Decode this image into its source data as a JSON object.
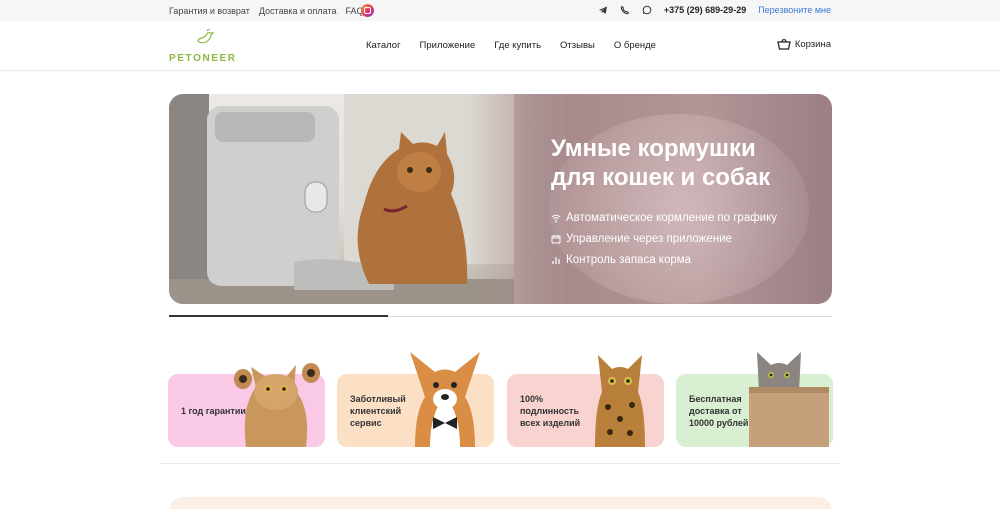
{
  "topbar": {
    "links": [
      "Гарантия и возврат",
      "Доставка и оплата",
      "FAQ"
    ],
    "instagram_icon": "instagram-icon",
    "messenger_icons": [
      "telegram-icon",
      "viber-icon",
      "whatsapp-icon"
    ],
    "phone": "+375 (29) 689-29-29",
    "callback": "Перезвоните мне"
  },
  "header": {
    "logo": "PETONEER",
    "nav": [
      "Каталог",
      "Приложение",
      "Где купить",
      "Отзывы",
      "О бренде"
    ],
    "cart": "Корзина"
  },
  "hero": {
    "title_line1": "Умные кормушки",
    "title_line2": "для кошек и собак",
    "features": [
      {
        "icon": "wifi-icon",
        "text": "Автоматическое кормление по графику"
      },
      {
        "icon": "calendar-icon",
        "text": "Управление через приложение"
      },
      {
        "icon": "bar-chart-icon",
        "text": "Контроль запаса корма"
      }
    ]
  },
  "slider": {
    "progress": 0.33
  },
  "features": [
    {
      "text": "1 год гарантии",
      "color": "#f9c9e6"
    },
    {
      "text": "Заботливый клиентский сервис",
      "color": "#fbe0c6"
    },
    {
      "text": "100% подлинность всех изделий",
      "color": "#f8d3cf"
    },
    {
      "text": "Бесплатная доставка от 10000 рублей",
      "color": "#d9efd2"
    }
  ],
  "colors": {
    "brand": "#8cb83f",
    "link": "#3c7bd8"
  }
}
